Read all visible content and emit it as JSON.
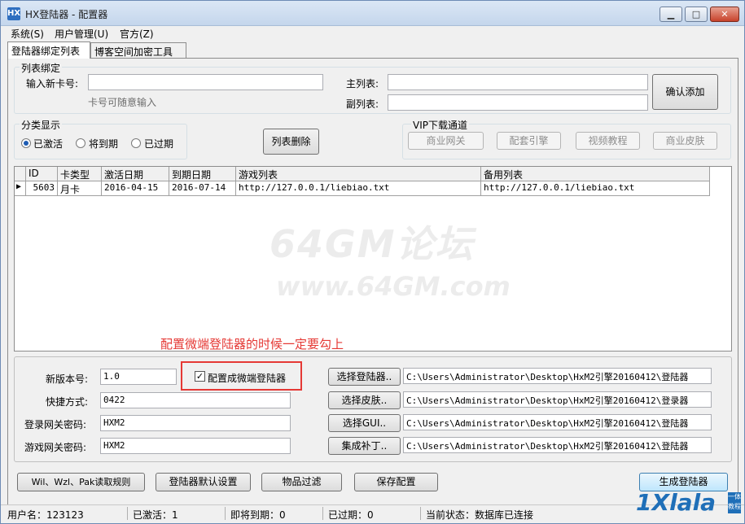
{
  "window": {
    "title": "HX登陆器 - 配置器",
    "icon_text": "HX"
  },
  "menu": [
    "系统(S)",
    "用户管理(U)",
    "官方(Z)"
  ],
  "tabs": [
    "登陆器绑定列表",
    "博客空间加密工具"
  ],
  "bind_group": {
    "title": "列表绑定",
    "card_label": "输入新卡号:",
    "card_hint": "卡号可随意输入",
    "main_list_label": "主列表:",
    "sub_list_label": "副列表:",
    "confirm_button": "确认添加"
  },
  "filter_group": {
    "title": "分类显示",
    "options": [
      "已激活",
      "将到期",
      "已过期"
    ],
    "selected": 0
  },
  "delete_button": "列表删除",
  "vip_group": {
    "title": "VIP下载通道",
    "buttons": [
      "商业网关",
      "配套引擎",
      "视频教程",
      "商业皮肤"
    ]
  },
  "table": {
    "columns": [
      "ID",
      "卡类型",
      "激活日期",
      "到期日期",
      "游戏列表",
      "备用列表"
    ],
    "rows": [
      [
        "5603",
        "月卡",
        "2016-04-15",
        "2016-07-14",
        "http://127.0.0.1/liebiao.txt",
        "http://127.0.0.1/liebiao.txt"
      ]
    ]
  },
  "watermark": {
    "line1": "64GM论坛",
    "line2": "www.64GM.com"
  },
  "annotation": "配置微端登陆器的时候一定要勾上",
  "config": {
    "version_label": "新版本号:",
    "version_value": "1.0",
    "micro_checkbox_label": "配置成微端登陆器",
    "micro_checked": true,
    "shortcut_label": "快捷方式:",
    "shortcut_value": "0422",
    "login_pwd_label": "登录网关密码:",
    "login_pwd_value": "HXM2",
    "game_pwd_label": "游戏网关密码:",
    "game_pwd_value": "HXM2",
    "select_buttons": [
      "选择登陆器..",
      "选择皮肤..",
      "选择GUI..",
      "集成补丁.."
    ],
    "paths": [
      "C:\\Users\\Administrator\\Desktop\\HxM2引擎20160412\\登陆器",
      "C:\\Users\\Administrator\\Desktop\\HxM2引擎20160412\\登录器",
      "C:\\Users\\Administrator\\Desktop\\HxM2引擎20160412\\登陆器",
      "C:\\Users\\Administrator\\Desktop\\HxM2引擎20160412\\登陆器"
    ]
  },
  "bottom_buttons": [
    "Wil、Wzl、Pak读取规则",
    "登陆器默认设置",
    "物品过滤",
    "保存配置",
    "生成登陆器"
  ],
  "status": {
    "user": "用户名：123123",
    "active": "已激活：1",
    "expiring": "即将到期：0",
    "expired": "已过期：0",
    "state": "当前状态：数据库已连接"
  },
  "logo": {
    "text": "1Xlala",
    "badge": "一体 教程"
  }
}
